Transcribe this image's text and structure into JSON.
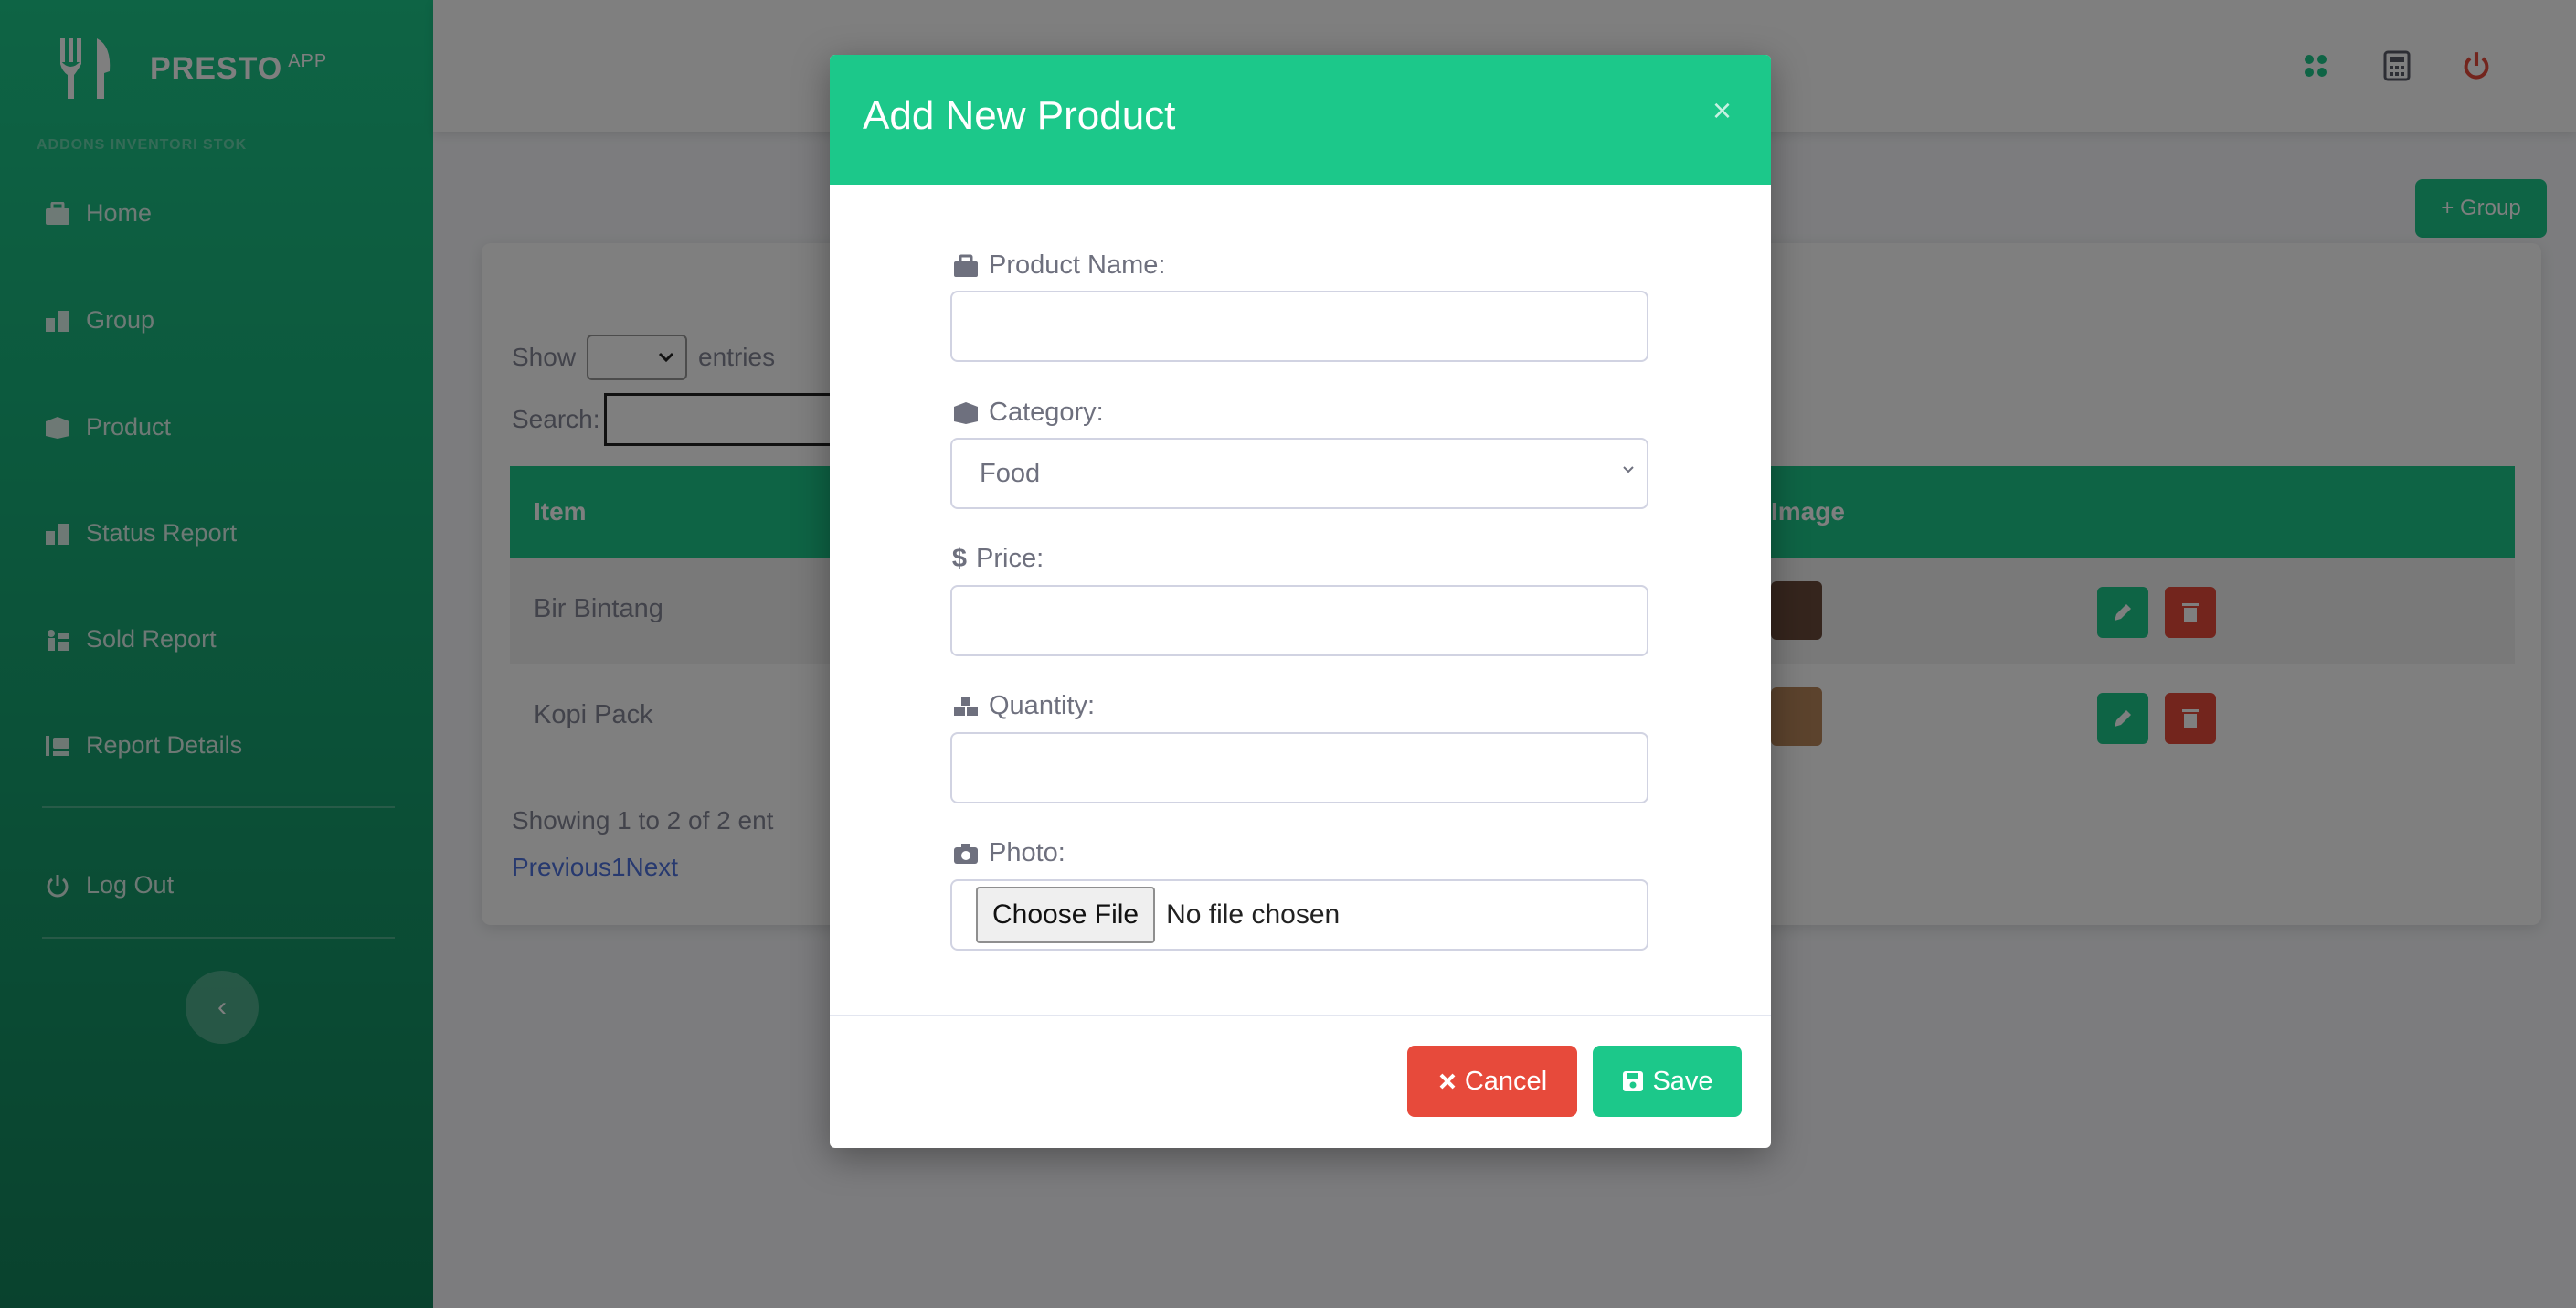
{
  "brand": {
    "name": "PRESTO",
    "sup": "APP",
    "subtitle": "ADDONS INVENTORI STOK"
  },
  "sidebar": {
    "items": [
      {
        "label": "Home",
        "icon": "home-icon"
      },
      {
        "label": "Group",
        "icon": "group-icon"
      },
      {
        "label": "Product",
        "icon": "product-icon"
      },
      {
        "label": "Status Report",
        "icon": "status-report-icon"
      },
      {
        "label": "Sold Report",
        "icon": "sold-report-icon"
      },
      {
        "label": "Report Details",
        "icon": "report-details-icon"
      },
      {
        "label": "Log Out",
        "icon": "power-icon"
      }
    ],
    "toggle": "‹"
  },
  "topbar": {
    "icons": [
      "network-icon",
      "calculator-icon",
      "power-icon"
    ]
  },
  "page": {
    "add_group_label": "+ Group",
    "show_label": "Show",
    "entries_label": "entries",
    "search_label": "Search:",
    "table": {
      "headers": [
        "Item",
        "Image"
      ],
      "rows": [
        {
          "item": "Bir Bintang"
        },
        {
          "item": "Kopi Pack"
        }
      ]
    },
    "info_text": "Showing 1 to 2 of 2 ent",
    "pager": "Previous1Next"
  },
  "modal": {
    "title": "Add New Product",
    "close": "×",
    "fields": {
      "product_name_label": "Product Name:",
      "product_name_value": "",
      "category_label": "Category:",
      "category_value": "Food",
      "price_label": "Price:",
      "price_value": "",
      "quantity_label": "Quantity:",
      "quantity_value": "",
      "photo_label": "Photo:",
      "file_button": "Choose File",
      "file_status": "No file chosen"
    },
    "cancel_label": "Cancel",
    "save_label": "Save"
  },
  "colors": {
    "primary": "#1cc88a",
    "danger": "#e74a3b",
    "link": "#4e73df"
  }
}
